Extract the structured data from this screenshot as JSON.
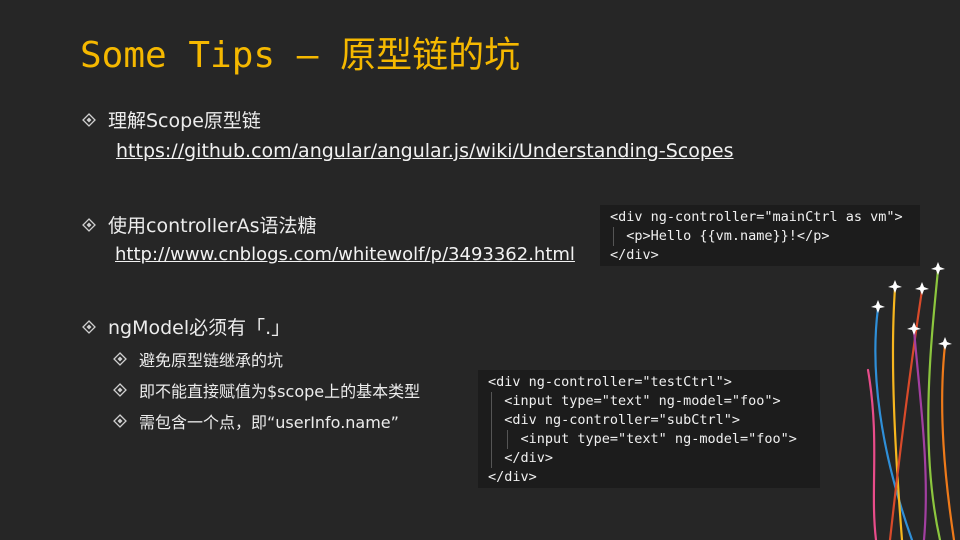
{
  "slide": {
    "title": "Some Tips – 原型链的坑",
    "bullets": [
      {
        "text": "理解Scope原型链",
        "link": "https://github.com/angular/angular.js/wiki/Understanding-Scopes"
      },
      {
        "text": "使用controllerAs语法糖",
        "link": "http://www.cnblogs.com/whitewolf/p/3493362.html"
      },
      {
        "text": "ngModel必须有「.」",
        "subs": [
          "避免原型链继承的坑",
          "即不能直接赋值为$scope上的基本类型",
          "需包含一个点，即“userInfo.name”"
        ]
      }
    ],
    "code1": [
      "<div ng-controller=\"mainCtrl as vm\">",
      "  <p>Hello {{vm.name}}!</p>",
      "</div>"
    ],
    "code2": [
      "<div ng-controller=\"testCtrl\">",
      "  <input type=\"text\" ng-model=\"foo\">",
      "  <div ng-controller=\"subCtrl\">",
      "    <input type=\"text\" ng-model=\"foo\">",
      "  </div>",
      "</div>"
    ],
    "colors": {
      "title": "#f5b800",
      "background": "#262626",
      "code_bg": "#1c1c1c"
    },
    "icons": {
      "bullet": "diamond-bullet-icon",
      "decoration": "airplane-trails-icon"
    }
  }
}
